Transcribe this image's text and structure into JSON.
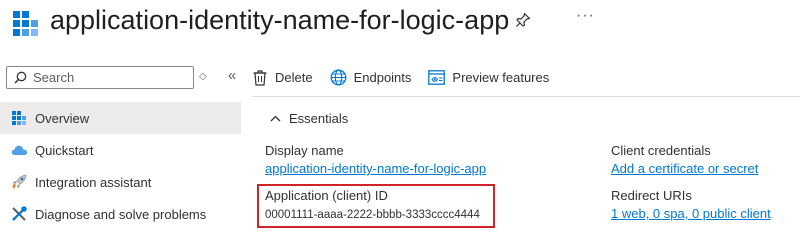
{
  "header": {
    "title": "application-identity-name-for-logic-app",
    "more_label": "···"
  },
  "nav": {
    "search_placeholder": "Search",
    "items": [
      {
        "label": "Overview",
        "active": true
      },
      {
        "label": "Quickstart",
        "active": false
      },
      {
        "label": "Integration assistant",
        "active": false
      },
      {
        "label": "Diagnose and solve problems",
        "active": false
      }
    ]
  },
  "toolbar": {
    "delete_label": "Delete",
    "endpoints_label": "Endpoints",
    "preview_label": "Preview features"
  },
  "essentials": {
    "title": "Essentials",
    "display_name_label": "Display name",
    "display_name_value": "application-identity-name-for-logic-app",
    "app_id_label": "Application (client) ID",
    "app_id_value": "00001111-aaaa-2222-bbbb-3333cccc4444",
    "client_credentials_label": "Client credentials",
    "client_credentials_value": "Add a certificate or secret",
    "redirect_uris_label": "Redirect URIs",
    "redirect_uris_value": "1 web, 0 spa, 0 public client"
  },
  "colors": {
    "accent": "#0078d4",
    "highlight": "#d1232a",
    "active_bg": "#edebe9"
  }
}
